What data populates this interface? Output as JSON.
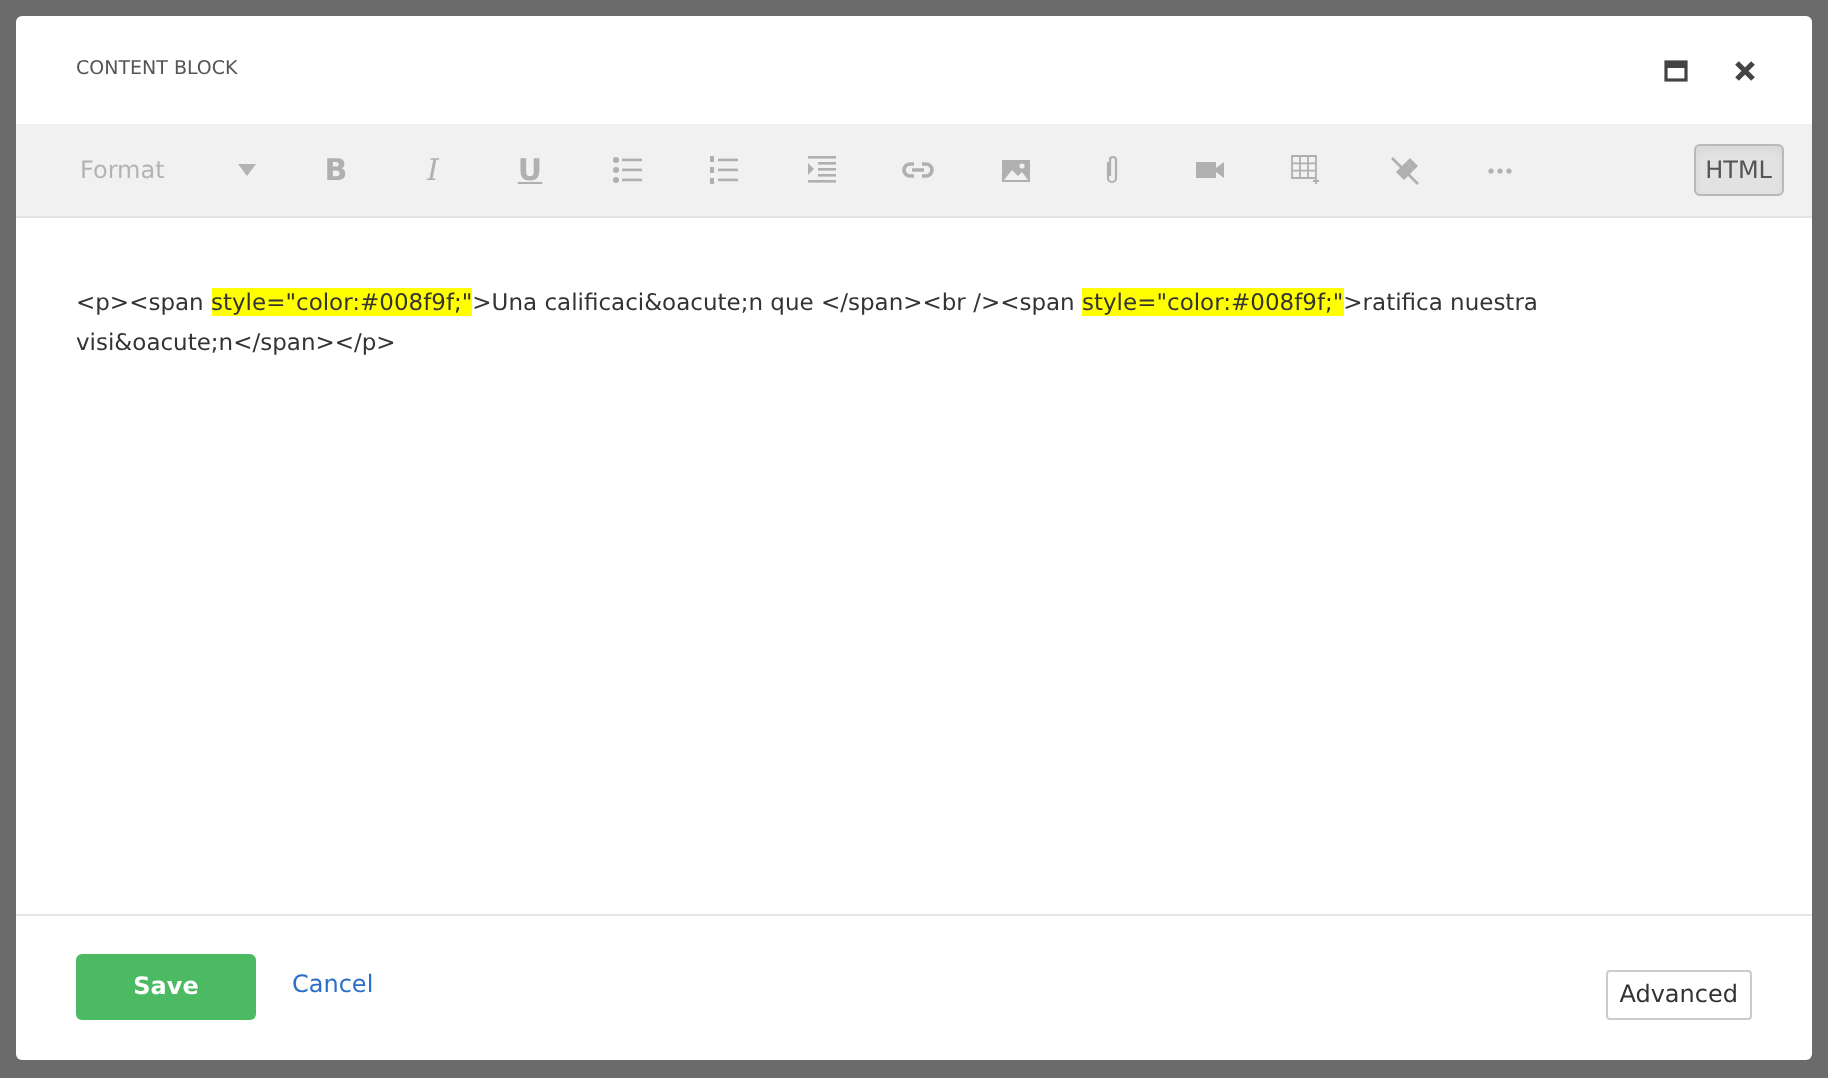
{
  "dialog": {
    "title": "CONTENT BLOCK"
  },
  "toolbar": {
    "format": {
      "label": "Format",
      "disabled": true
    },
    "tools": [
      {
        "kind": "bold",
        "label": "B",
        "disabled": true
      },
      {
        "kind": "italic",
        "label": "I",
        "disabled": true
      },
      {
        "kind": "underline",
        "label": "U",
        "disabled": true
      },
      {
        "kind": "bullets",
        "disabled": true
      },
      {
        "kind": "numbers",
        "disabled": true
      },
      {
        "kind": "indent",
        "disabled": true
      },
      {
        "kind": "link",
        "disabled": true
      },
      {
        "kind": "image",
        "disabled": true
      },
      {
        "kind": "attach",
        "disabled": true
      },
      {
        "kind": "video",
        "disabled": true
      },
      {
        "kind": "table",
        "disabled": true
      },
      {
        "kind": "clear",
        "disabled": true
      },
      {
        "kind": "more",
        "disabled": true
      }
    ],
    "html": {
      "label": "HTML",
      "selected": true
    }
  },
  "source": [
    {
      "text": "<p><span ",
      "highlighted": false
    },
    {
      "text": "style=\"color:#008f9f;\"",
      "highlighted": true
    },
    {
      "text": ">Una calificaci&oacute;n que </span><br /><span ",
      "highlighted": false
    },
    {
      "text": "style=\"color:#008f9f;\"",
      "highlighted": true
    },
    {
      "text": ">ratifica nuestra visi&oacute;n</span></p>",
      "highlighted": false
    }
  ],
  "footer": {
    "save": "Save",
    "cancel": "Cancel",
    "advanced": "Advanced"
  }
}
